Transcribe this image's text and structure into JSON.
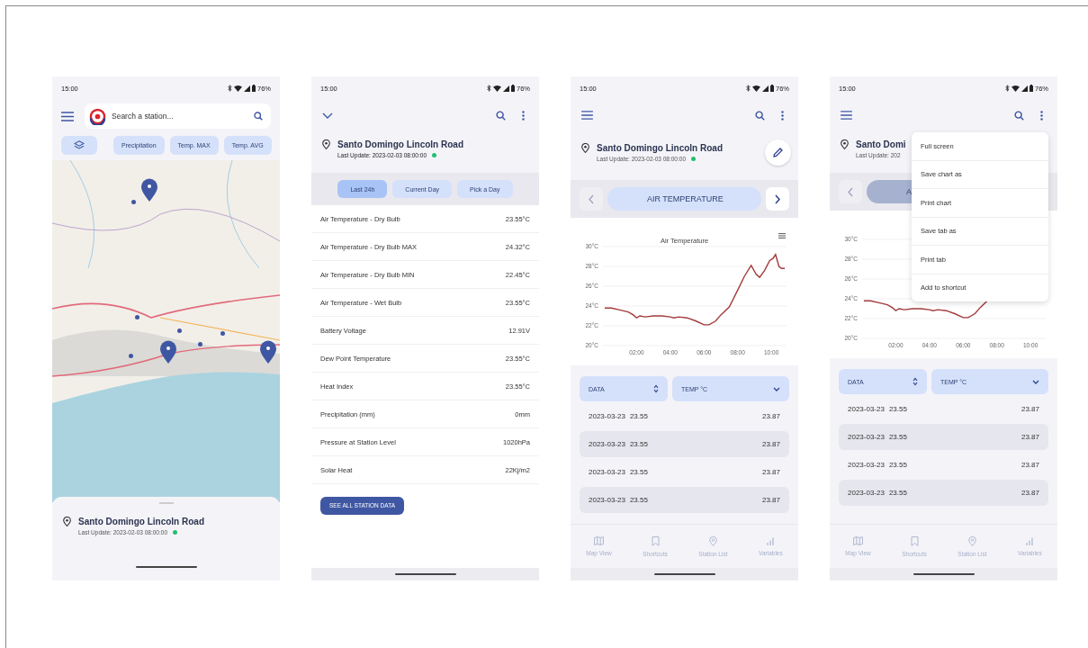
{
  "screens": [
    {
      "kind": "map",
      "status_bar": {
        "time": "15:00",
        "battery": "76%"
      },
      "search": {
        "placeholder": "Search a station..."
      },
      "filters": [
        "Precipitation",
        "Temp. MAX",
        "Temp. AVG"
      ],
      "station": {
        "name": "Santo Domingo Lincoln Road",
        "last_update": "Last Update: 2023-02-03  08:00:00",
        "online": true
      }
    },
    {
      "kind": "detail",
      "status_bar": {
        "time": "15:00",
        "battery": "76%"
      },
      "station": {
        "name": "Santo Domingo Lincoln Road",
        "last_update": "Last Update: 2023-02-03  08:00:00",
        "online": true
      },
      "periods": [
        {
          "label": "Last 24h",
          "selected": true
        },
        {
          "label": "Current Day",
          "selected": false
        },
        {
          "label": "Pick a Day",
          "selected": false
        }
      ],
      "readings": [
        {
          "label": "Air Temperature - Dry Bulb",
          "value": "23.55°C"
        },
        {
          "label": "Air Temperature - Dry Bulb MAX",
          "value": "24.32°C"
        },
        {
          "label": "Air Temperature - Dry Bulb MIN",
          "value": "22.45°C"
        },
        {
          "label": "Air Temperature - Wet Bulb",
          "value": "23.55°C"
        },
        {
          "label": "Battery Voltage",
          "value": "12.91V"
        },
        {
          "label": "Dew Point Temperature",
          "value": "23.55°C"
        },
        {
          "label": "Heat Index",
          "value": "23.55°C"
        },
        {
          "label": "Precipitation (mm)",
          "value": "0mm"
        },
        {
          "label": "Pressure at Station Level",
          "value": "1020hPa"
        },
        {
          "label": "Solar Heat",
          "value": "22Kj/m2"
        }
      ],
      "action": "SEE ALL STATION DATA"
    },
    {
      "kind": "chart",
      "status_bar": {
        "time": "15:00",
        "battery": "76%"
      },
      "station": {
        "name": "Santo Domingo Lincoln Road",
        "last_update": "Last Update: 2023-02-03  08:00:00",
        "online": true
      },
      "variable": {
        "label": "AIR TEMPERATURE",
        "pressed": false
      },
      "chart_data": {
        "type": "line",
        "title": "Air Temperature",
        "grid": true,
        "x": [
          0.1,
          0.5,
          1,
          1.5,
          1.8,
          2,
          2.2,
          2.5,
          3,
          3.5,
          4,
          4.2,
          4.5,
          5,
          5.5,
          6,
          6.3,
          6.7,
          7,
          7.5,
          8,
          8.4,
          8.8,
          9.1,
          9.3,
          9.6,
          9.9,
          10.1,
          10.25,
          10.45,
          10.6,
          10.8
        ],
        "series": [
          {
            "color": "#a33a3a",
            "values": [
              23.8,
              23.8,
              23.6,
              23.4,
              23.1,
              22.8,
              23.0,
              22.9,
              23.0,
              23.0,
              22.9,
              22.8,
              22.9,
              22.8,
              22.5,
              22.1,
              22.1,
              22.5,
              23.1,
              23.9,
              25.6,
              27.0,
              28.1,
              27.2,
              26.9,
              27.6,
              28.6,
              28.8,
              29.2,
              28.0,
              27.8,
              27.8
            ]
          }
        ],
        "xlim": [
          0,
          10.9
        ],
        "ylim": [
          20,
          30
        ],
        "xticks": [
          {
            "value": 2,
            "label": "02:00"
          },
          {
            "value": 4,
            "label": "04:00"
          },
          {
            "value": 6,
            "label": "06:00"
          },
          {
            "value": 8,
            "label": "08:00"
          },
          {
            "value": 10,
            "label": "10:00"
          }
        ],
        "yticks": [
          {
            "value": 20,
            "label": "20°C"
          },
          {
            "value": 22,
            "label": "22°C"
          },
          {
            "value": 24,
            "label": "24°C"
          },
          {
            "value": 26,
            "label": "26°C"
          },
          {
            "value": 28,
            "label": "28°C"
          },
          {
            "value": 30,
            "label": "30°C"
          }
        ]
      },
      "table": {
        "columns": [
          "DATA",
          "TEMP °C"
        ],
        "rows": [
          {
            "date": "2023-03-23",
            "time": "23.55",
            "value": "23.87"
          },
          {
            "date": "2023-03-23",
            "time": "23.55",
            "value": "23.87"
          },
          {
            "date": "2023-03-23",
            "time": "23.55",
            "value": "23.87"
          },
          {
            "date": "2023-03-23",
            "time": "23.55",
            "value": "23.87"
          }
        ]
      },
      "nav": [
        {
          "kind": "map",
          "label": "Map View"
        },
        {
          "kind": "bookmark",
          "label": "Shortcuts"
        },
        {
          "kind": "pin",
          "label": "Station List"
        },
        {
          "kind": "bars",
          "label": "Variables"
        }
      ]
    },
    {
      "kind": "chart",
      "status_bar": {
        "time": "15:00",
        "battery": "76%"
      },
      "station": {
        "name": "Santo Domi",
        "last_update": "Last Update: 202"
      },
      "variable": {
        "label": "A",
        "pressed": true
      },
      "chart_data": {
        "type": "line",
        "grid": true,
        "x": [
          0.1,
          0.5,
          1,
          1.5,
          1.8,
          2,
          2.2,
          2.5,
          3,
          3.5,
          4,
          4.2,
          4.5,
          5,
          5.5,
          6,
          6.3,
          6.7,
          7,
          7.5
        ],
        "series": [
          {
            "color": "#a33a3a",
            "values": [
              23.8,
              23.8,
              23.6,
              23.4,
              23.1,
              22.8,
              23.0,
              22.9,
              23.0,
              23.0,
              22.9,
              22.8,
              22.9,
              22.8,
              22.5,
              22.1,
              22.1,
              22.5,
              23.1,
              23.9
            ]
          }
        ],
        "xlim": [
          0,
          10.9
        ],
        "ylim": [
          20,
          30
        ],
        "xticks": [
          {
            "value": 2,
            "label": "02:00"
          },
          {
            "value": 4,
            "label": "04:00"
          },
          {
            "value": 6,
            "label": "06:00"
          },
          {
            "value": 8,
            "label": "08:00"
          },
          {
            "value": 10,
            "label": "10:00"
          }
        ],
        "yticks": [
          {
            "value": 20,
            "label": "20°C"
          },
          {
            "value": 22,
            "label": "22°C"
          },
          {
            "value": 24,
            "label": "24°C"
          },
          {
            "value": 26,
            "label": "26°C"
          },
          {
            "value": 28,
            "label": "28°C"
          },
          {
            "value": 30,
            "label": "30°C"
          }
        ]
      },
      "table": {
        "columns": [
          "DATA",
          "TEMP °C"
        ],
        "rows": [
          {
            "date": "2023-03-23",
            "time": "23.55",
            "value": "23.87"
          },
          {
            "date": "2023-03-23",
            "time": "23.55",
            "value": "23.87"
          },
          {
            "date": "2023-03-23",
            "time": "23.55",
            "value": "23.87"
          },
          {
            "date": "2023-03-23",
            "time": "23.55",
            "value": "23.87"
          }
        ]
      },
      "nav": [
        {
          "kind": "map",
          "label": "Map View"
        },
        {
          "kind": "bookmark",
          "label": "Shortcuts"
        },
        {
          "kind": "pin",
          "label": "Station List"
        },
        {
          "kind": "bars",
          "label": "Variables"
        }
      ],
      "menu": [
        "Full screen",
        "Save chart as",
        "Print chart",
        "Save tab as",
        "Print tab",
        "Add to shortcut"
      ]
    }
  ]
}
